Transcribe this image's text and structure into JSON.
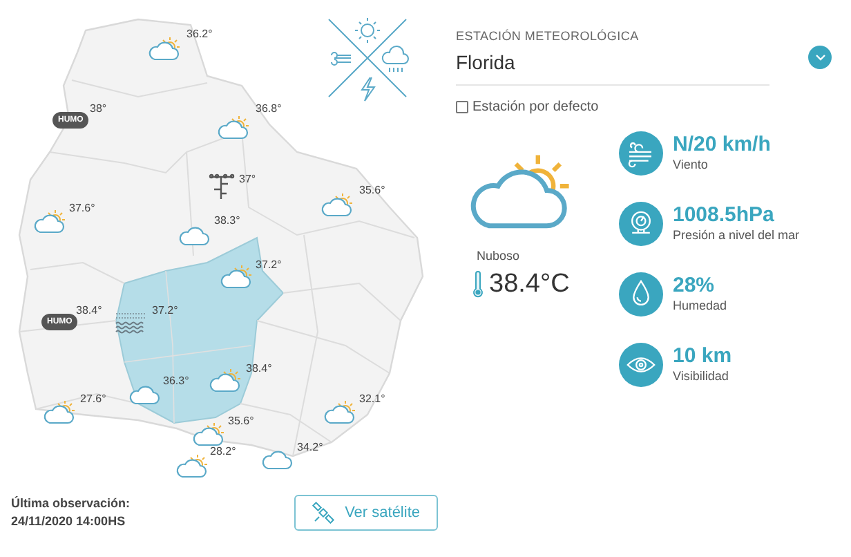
{
  "map": {
    "stations": [
      {
        "kind": "partly_cloudy",
        "temperature": "36.2°"
      },
      {
        "kind": "smoke",
        "label": "HUMO",
        "temperature": "38°"
      },
      {
        "kind": "partly_cloudy",
        "temperature": "36.8°"
      },
      {
        "kind": "station",
        "temperature": "37°"
      },
      {
        "kind": "partly_cloudy",
        "temperature": "35.6°"
      },
      {
        "kind": "partly_cloudy",
        "temperature": "37.6°"
      },
      {
        "kind": "cloudy",
        "temperature": "38.3°"
      },
      {
        "kind": "partly_cloudy",
        "temperature": "37.2°"
      },
      {
        "kind": "smoke",
        "label": "HUMO",
        "temperature": "38.4°"
      },
      {
        "kind": "fog",
        "temperature": "37.2°"
      },
      {
        "kind": "cloudy",
        "temperature": "36.3°"
      },
      {
        "kind": "partly_cloudy",
        "temperature": "38.4°"
      },
      {
        "kind": "partly_cloudy",
        "temperature": "27.6°"
      },
      {
        "kind": "partly_cloudy",
        "temperature": "32.1°"
      },
      {
        "kind": "partly_cloudy",
        "temperature": "35.6°"
      },
      {
        "kind": "partly_cloudy",
        "temperature": "28.2°"
      },
      {
        "kind": "cloudy",
        "temperature": "34.2°"
      }
    ]
  },
  "station_select": {
    "label": "ESTACIÓN METEOROLÓGICA",
    "value": "Florida"
  },
  "default_station": {
    "label": "Estación por defecto",
    "checked": false
  },
  "current": {
    "kind": "partly_cloudy",
    "condition": "Nuboso",
    "temperature": "38.4°C"
  },
  "metrics": [
    {
      "kind": "wind",
      "value": "N/20 km/h",
      "label": "Viento"
    },
    {
      "kind": "pressure",
      "value": "1008.5hPa",
      "label": "Presión a nivel del mar"
    },
    {
      "kind": "humidity",
      "value": "28%",
      "label": "Humedad"
    },
    {
      "kind": "visibility",
      "value": "10 km",
      "label": "Visibilidad"
    }
  ],
  "footer": {
    "observation_label": "Última observación:",
    "timestamp": "24/11/2020 14:00HS",
    "satellite_button": "Ver satélite"
  }
}
